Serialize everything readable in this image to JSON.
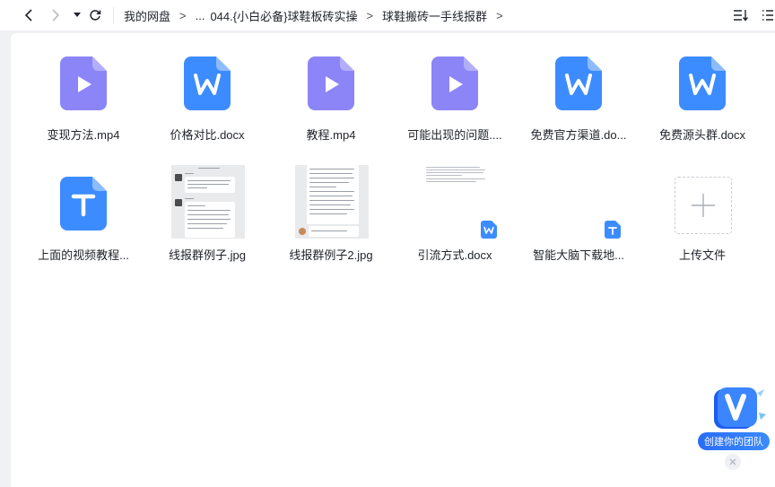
{
  "breadcrumb": {
    "items": [
      "我的网盘",
      "...",
      "044.{小白必备}球鞋板砖实操",
      "球鞋搬砖一手线报群"
    ],
    "separator": ">"
  },
  "icons": {
    "back": "chevron-left-icon",
    "forward": "chevron-right-icon",
    "history": "caret-down-icon",
    "refresh": "refresh-icon",
    "sort": "sort-icon",
    "view": "list-view-icon"
  },
  "files": [
    {
      "name": "变现方法.mp4",
      "type": "video"
    },
    {
      "name": "价格对比.docx",
      "type": "word"
    },
    {
      "name": "教程.mp4",
      "type": "video"
    },
    {
      "name": "可能出现的问题....",
      "type": "video"
    },
    {
      "name": "免费官方渠道.do...",
      "type": "word"
    },
    {
      "name": "免费源头群.docx",
      "type": "word"
    },
    {
      "name": "上面的视频教程...",
      "type": "text"
    },
    {
      "name": "线报群例子.jpg",
      "type": "image"
    },
    {
      "name": "线报群例子2.jpg",
      "type": "image"
    },
    {
      "name": "引流方式.docx",
      "type": "word-preview"
    },
    {
      "name": "智能大脑下载地...",
      "type": "text-preview"
    }
  ],
  "upload": {
    "label": "上传文件"
  },
  "team": {
    "label": "创建你的团队",
    "badge": "V"
  },
  "colors": {
    "video": "#8b85f7",
    "word": "#3d8cff",
    "text": "#3d8cff",
    "team": "#2a6cf6"
  }
}
